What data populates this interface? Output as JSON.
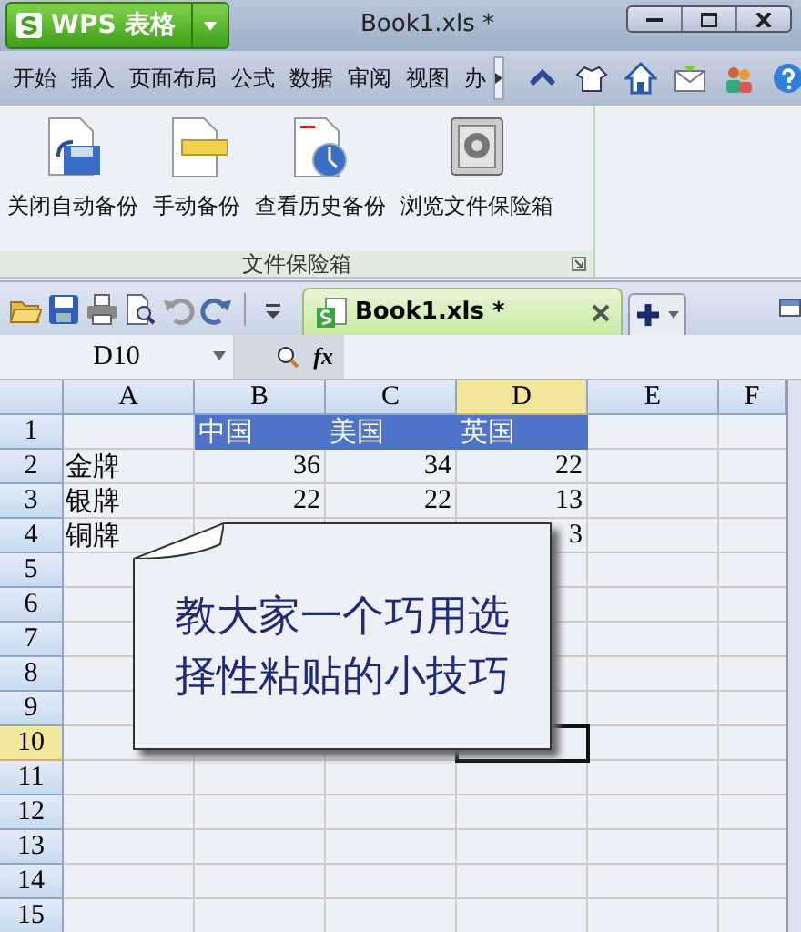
{
  "window": {
    "app_button": "WPS 表格",
    "title": "Book1.xls *"
  },
  "menu_tabs": [
    {
      "label": "开始"
    },
    {
      "label": "插入"
    },
    {
      "label": "页面布局"
    },
    {
      "label": "公式"
    },
    {
      "label": "数据"
    },
    {
      "label": "审阅"
    },
    {
      "label": "视图"
    },
    {
      "label": "办"
    }
  ],
  "ribbon": {
    "buttons": [
      {
        "label": "关闭自动备份",
        "kind": "backup-off"
      },
      {
        "label": "手动备份",
        "kind": "manual"
      },
      {
        "label": "查看历史备份",
        "kind": "history"
      },
      {
        "label": "浏览文件保险箱",
        "kind": "safe"
      }
    ],
    "group_label": "文件保险箱"
  },
  "doc_tab": {
    "label": "Book1.xls *"
  },
  "name_box": "D10",
  "formula_icon": "fx",
  "sheet": {
    "columns": [
      {
        "label": "A",
        "selected": false
      },
      {
        "label": "B",
        "selected": false
      },
      {
        "label": "C",
        "selected": false
      },
      {
        "label": "D",
        "selected": true
      },
      {
        "label": "E",
        "selected": false
      },
      {
        "label": "F",
        "selected": false
      }
    ],
    "rows": [
      {
        "label": "1",
        "selected": false,
        "kind": "header",
        "cells": [
          null,
          "中国",
          "美国",
          "英国"
        ]
      },
      {
        "label": "2",
        "selected": false,
        "kind": "data",
        "cells": [
          "金牌",
          "36",
          "34",
          "22"
        ]
      },
      {
        "label": "3",
        "selected": false,
        "kind": "data",
        "cells": [
          "银牌",
          "22",
          "22",
          "13"
        ]
      },
      {
        "label": "4",
        "selected": false,
        "kind": "data",
        "cells": [
          "铜牌",
          null,
          null,
          "3"
        ]
      },
      {
        "label": "5",
        "selected": false
      },
      {
        "label": "6",
        "selected": false
      },
      {
        "label": "7",
        "selected": false
      },
      {
        "label": "8",
        "selected": false
      },
      {
        "label": "9",
        "selected": false
      },
      {
        "label": "10",
        "selected": true
      },
      {
        "label": "11",
        "selected": false
      },
      {
        "label": "12",
        "selected": false
      },
      {
        "label": "13",
        "selected": false
      },
      {
        "label": "14",
        "selected": false
      },
      {
        "label": "15",
        "selected": false
      }
    ]
  },
  "callout": {
    "text": "教大家一个巧用选择性粘贴的小技巧"
  }
}
